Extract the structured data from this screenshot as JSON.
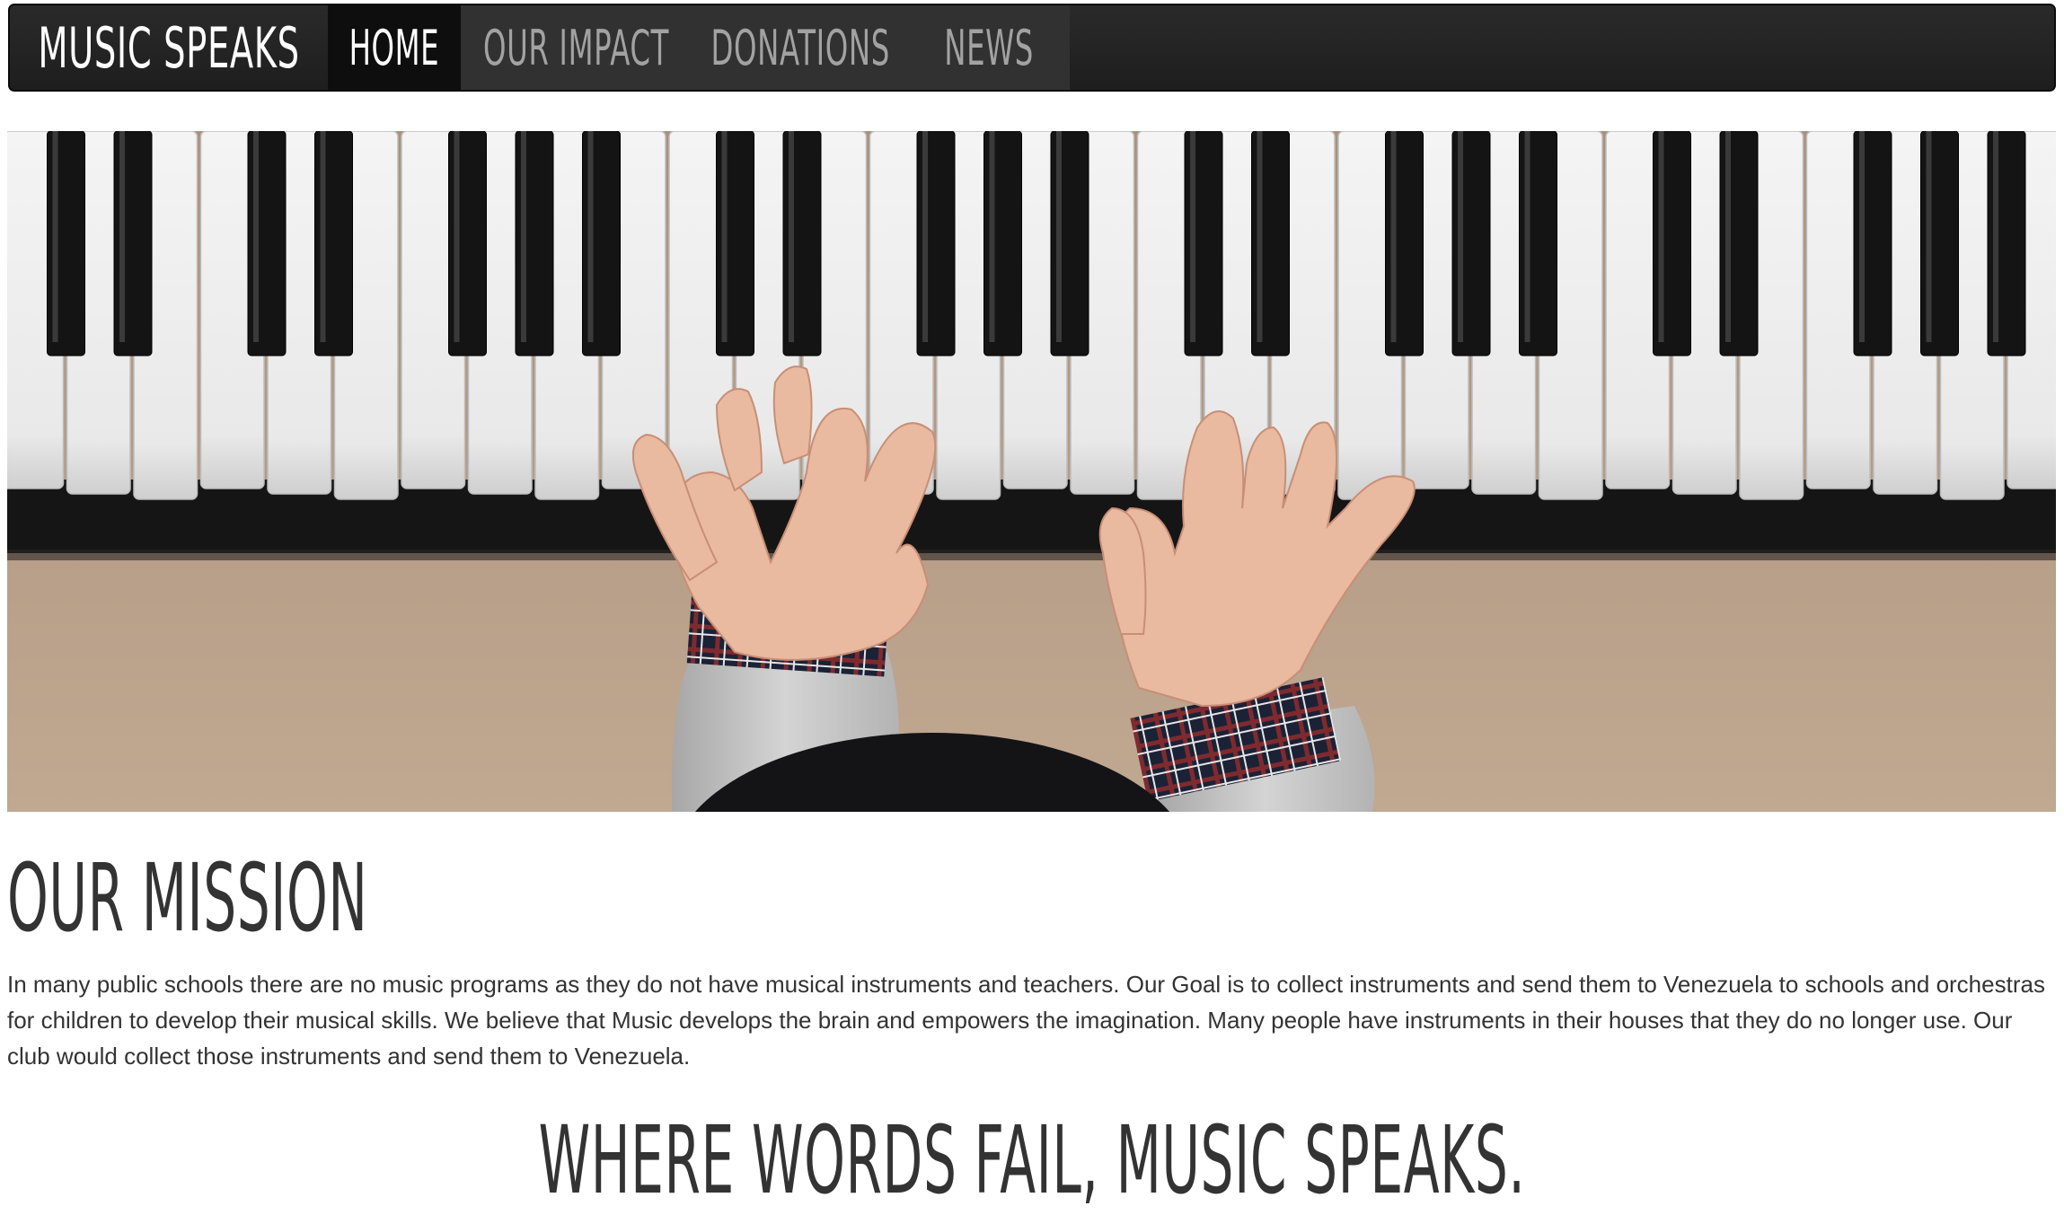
{
  "navbar": {
    "brand": "Music Speaks",
    "items": [
      {
        "label": "Home",
        "active": true
      },
      {
        "label": "Our Impact",
        "active": false
      },
      {
        "label": "Donations",
        "active": false
      },
      {
        "label": "News",
        "active": false
      }
    ]
  },
  "hero": {
    "image_subject": "child's hands playing piano keys"
  },
  "mission": {
    "title": "Our Mission",
    "text": "In many public schools there are no music programs as they do not have musical instruments and teachers. Our Goal is to collect instruments and send them to Venezuela to schools and orchestras for children to develop their musical skills. We believe that Music develops the brain and empowers the imagination. Many people have instruments in their houses that they do no longer use. Our club would collect those instruments and send them to Venezuela."
  },
  "tagline": "Where words fail, music speaks.",
  "colors": {
    "navbar_bg": "#222222",
    "nav_active_bg": "#0e0e0e",
    "nav_group_bg": "#313131",
    "nav_text": "#a2a2a2",
    "nav_active_text": "#ffffff",
    "body_text": "#333333"
  }
}
